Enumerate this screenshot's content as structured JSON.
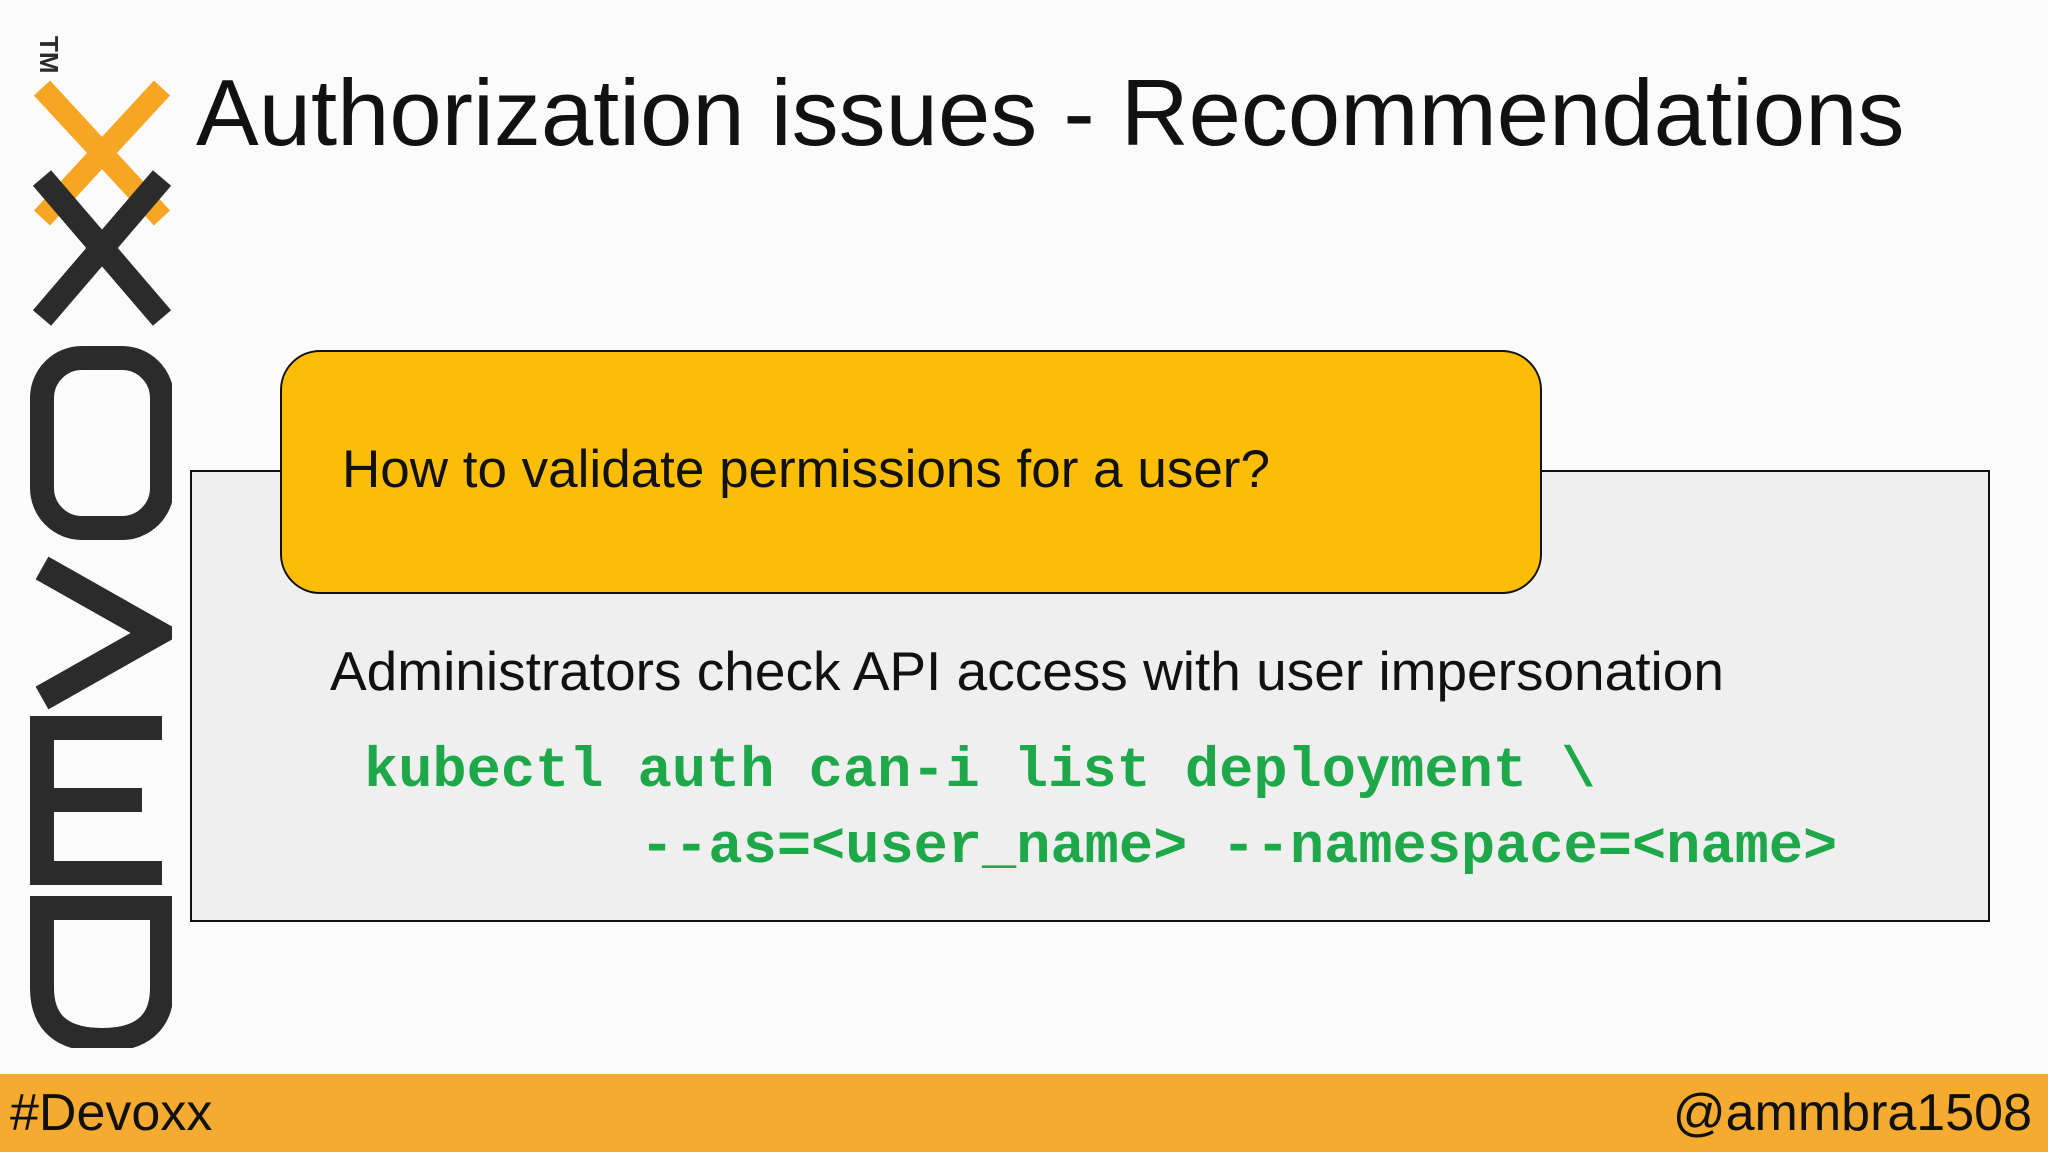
{
  "slide": {
    "title": "Authorization issues - Recommendations",
    "logo_text": "DEVOXX",
    "logo_trademark": "TM",
    "callout": {
      "text": "How to validate permissions for a user?"
    },
    "description": "Administrators check API access with user impersonation",
    "code": {
      "line1": "kubectl auth can-i list deployment \\",
      "line2": "--as=<user_name> --namespace=<name>"
    },
    "footer": {
      "hashtag": "#Devoxx",
      "handle": "@ammbra1508"
    }
  },
  "colors": {
    "background": "#fbfbfb",
    "callout_yellow": "#fcbd06",
    "panel_grey": "#efeff0",
    "code_green": "#1ea84a",
    "footer_orange": "#f4ab30",
    "logo_dark": "#2b2b2b",
    "logo_orange": "#f6a623"
  }
}
